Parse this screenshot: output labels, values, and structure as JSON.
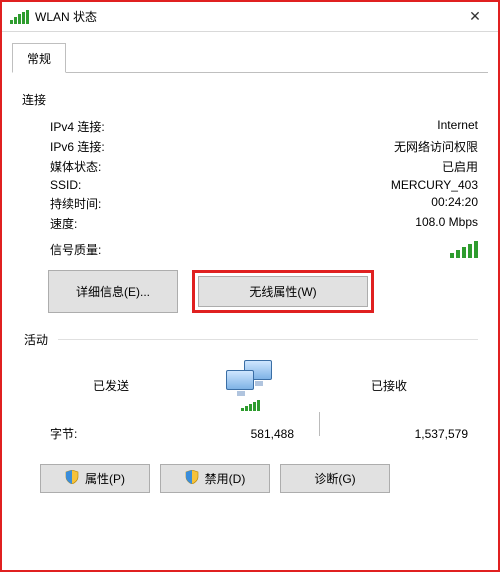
{
  "window": {
    "title": "WLAN 状态",
    "close": "✕"
  },
  "tab": {
    "general": "常规"
  },
  "connection": {
    "label": "连接",
    "ipv4_k": "IPv4 连接:",
    "ipv4_v": "Internet",
    "ipv6_k": "IPv6 连接:",
    "ipv6_v": "无网络访问权限",
    "media_k": "媒体状态:",
    "media_v": "已启用",
    "ssid_k": "SSID:",
    "ssid_v": "MERCURY_403",
    "duration_k": "持续时间:",
    "duration_v": "00:24:20",
    "speed_k": "速度:",
    "speed_v": "108.0 Mbps",
    "signal_k": "信号质量:"
  },
  "buttons": {
    "details": "详细信息(E)...",
    "wireless": "无线属性(W)",
    "properties": "属性(P)",
    "disable": "禁用(D)",
    "diagnose": "诊断(G)"
  },
  "activity": {
    "label": "活动",
    "sent": "已发送",
    "recv": "已接收",
    "bytes_label": "字节:",
    "bytes_sent": "581,488",
    "bytes_recv": "1,537,579"
  }
}
